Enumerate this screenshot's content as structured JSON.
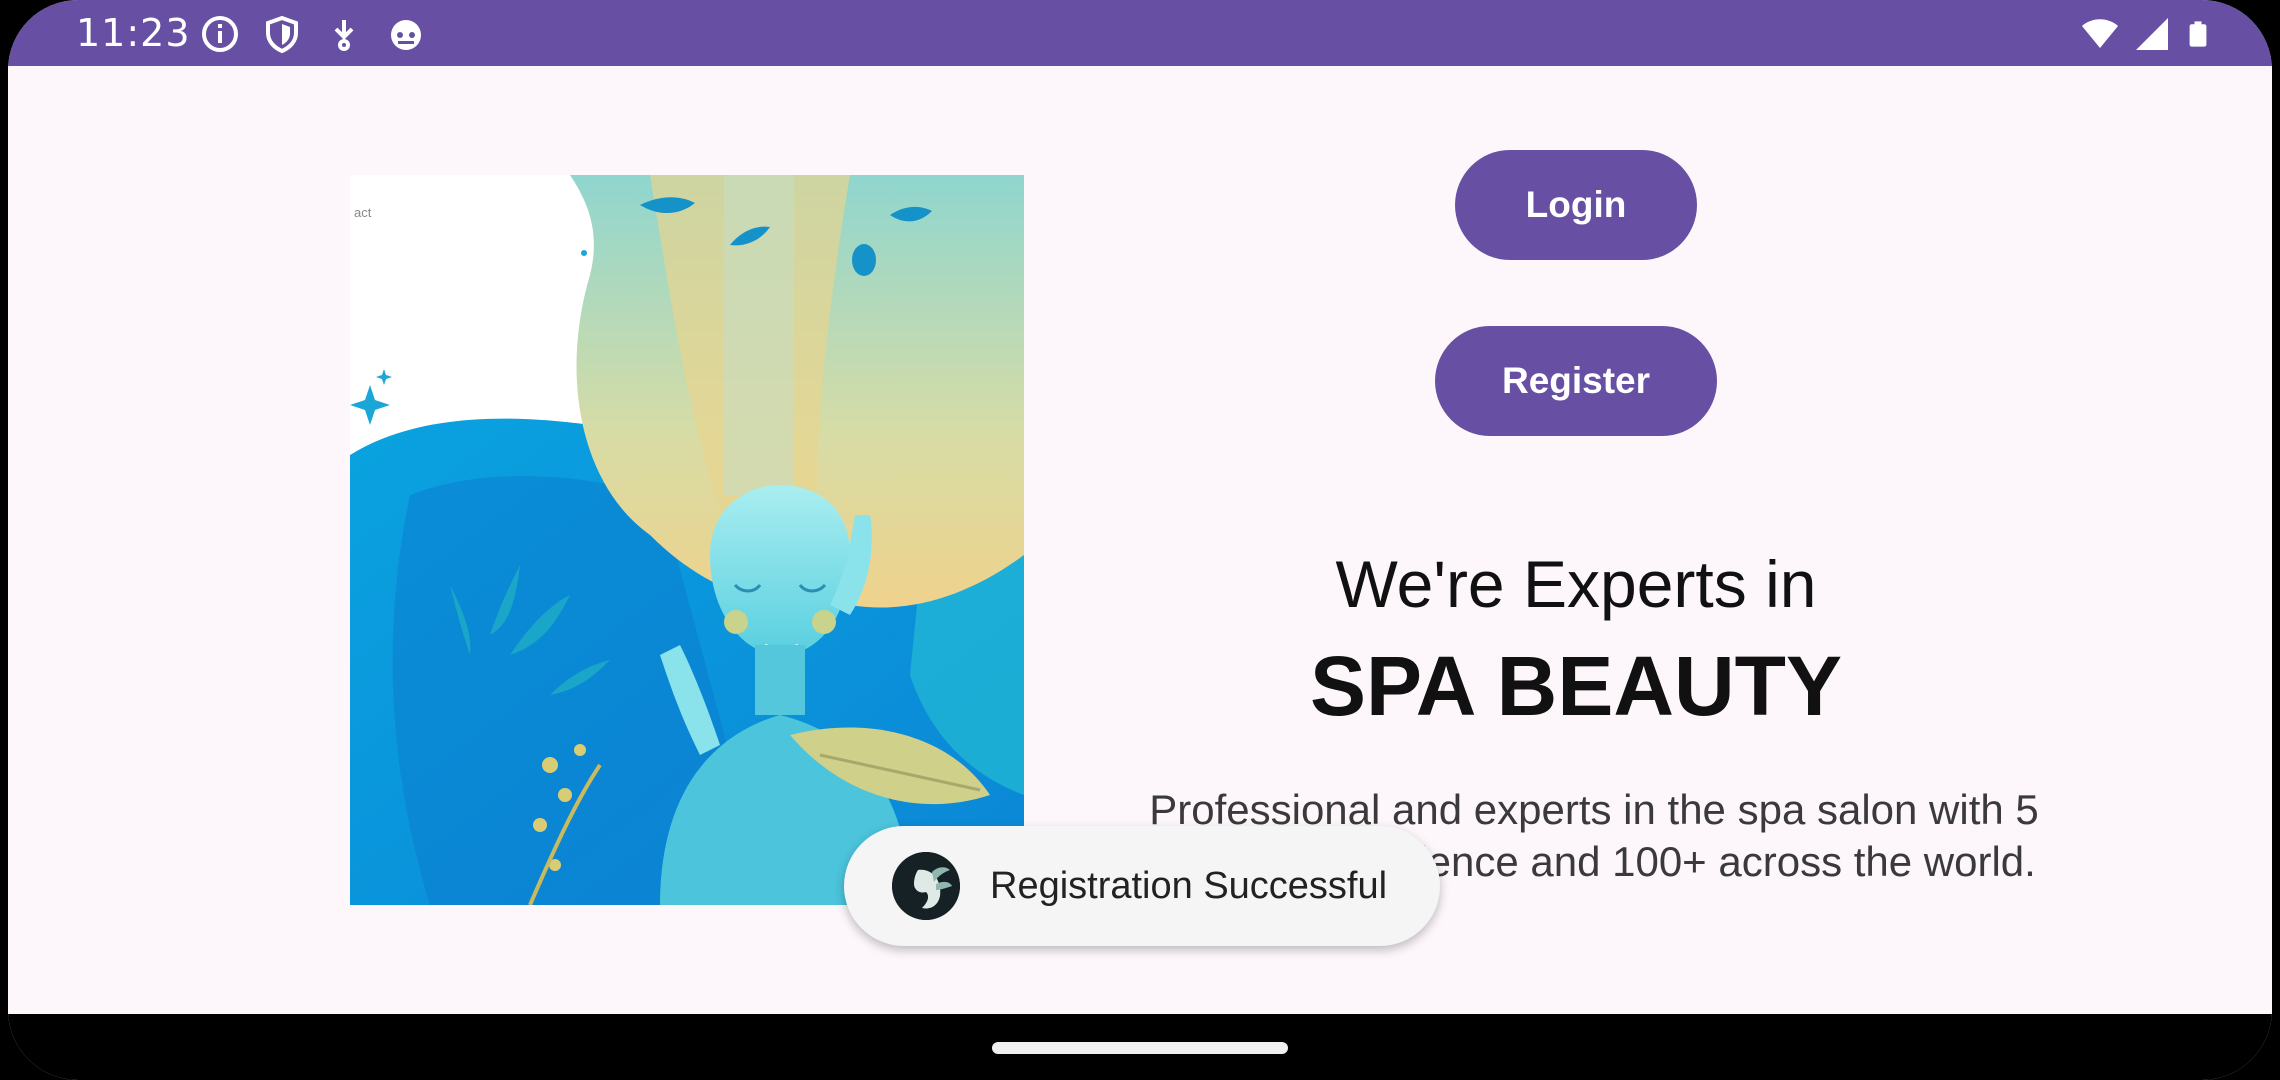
{
  "status_bar": {
    "time": "11:23",
    "left_icons": [
      "info-icon",
      "shield-icon",
      "download-icon",
      "android-icon"
    ],
    "right_icons": [
      "wifi-icon",
      "signal-icon",
      "battery-icon"
    ]
  },
  "hero": {
    "tag_text": "act",
    "image_description_icon": "spa-woman-illustration"
  },
  "buttons": {
    "login_label": "Login",
    "register_label": "Register"
  },
  "headline": {
    "line1": "We're Experts in",
    "line2": "SPA BEAUTY"
  },
  "description": "Professional and experts in the spa salon with 5 years of experience and 100+ across the world.",
  "toast": {
    "message": "Registration Successful",
    "icon": "spa-logo-icon"
  },
  "colors": {
    "primary": "#6750a4",
    "background": "#fdf7fc",
    "text": "#111111"
  }
}
